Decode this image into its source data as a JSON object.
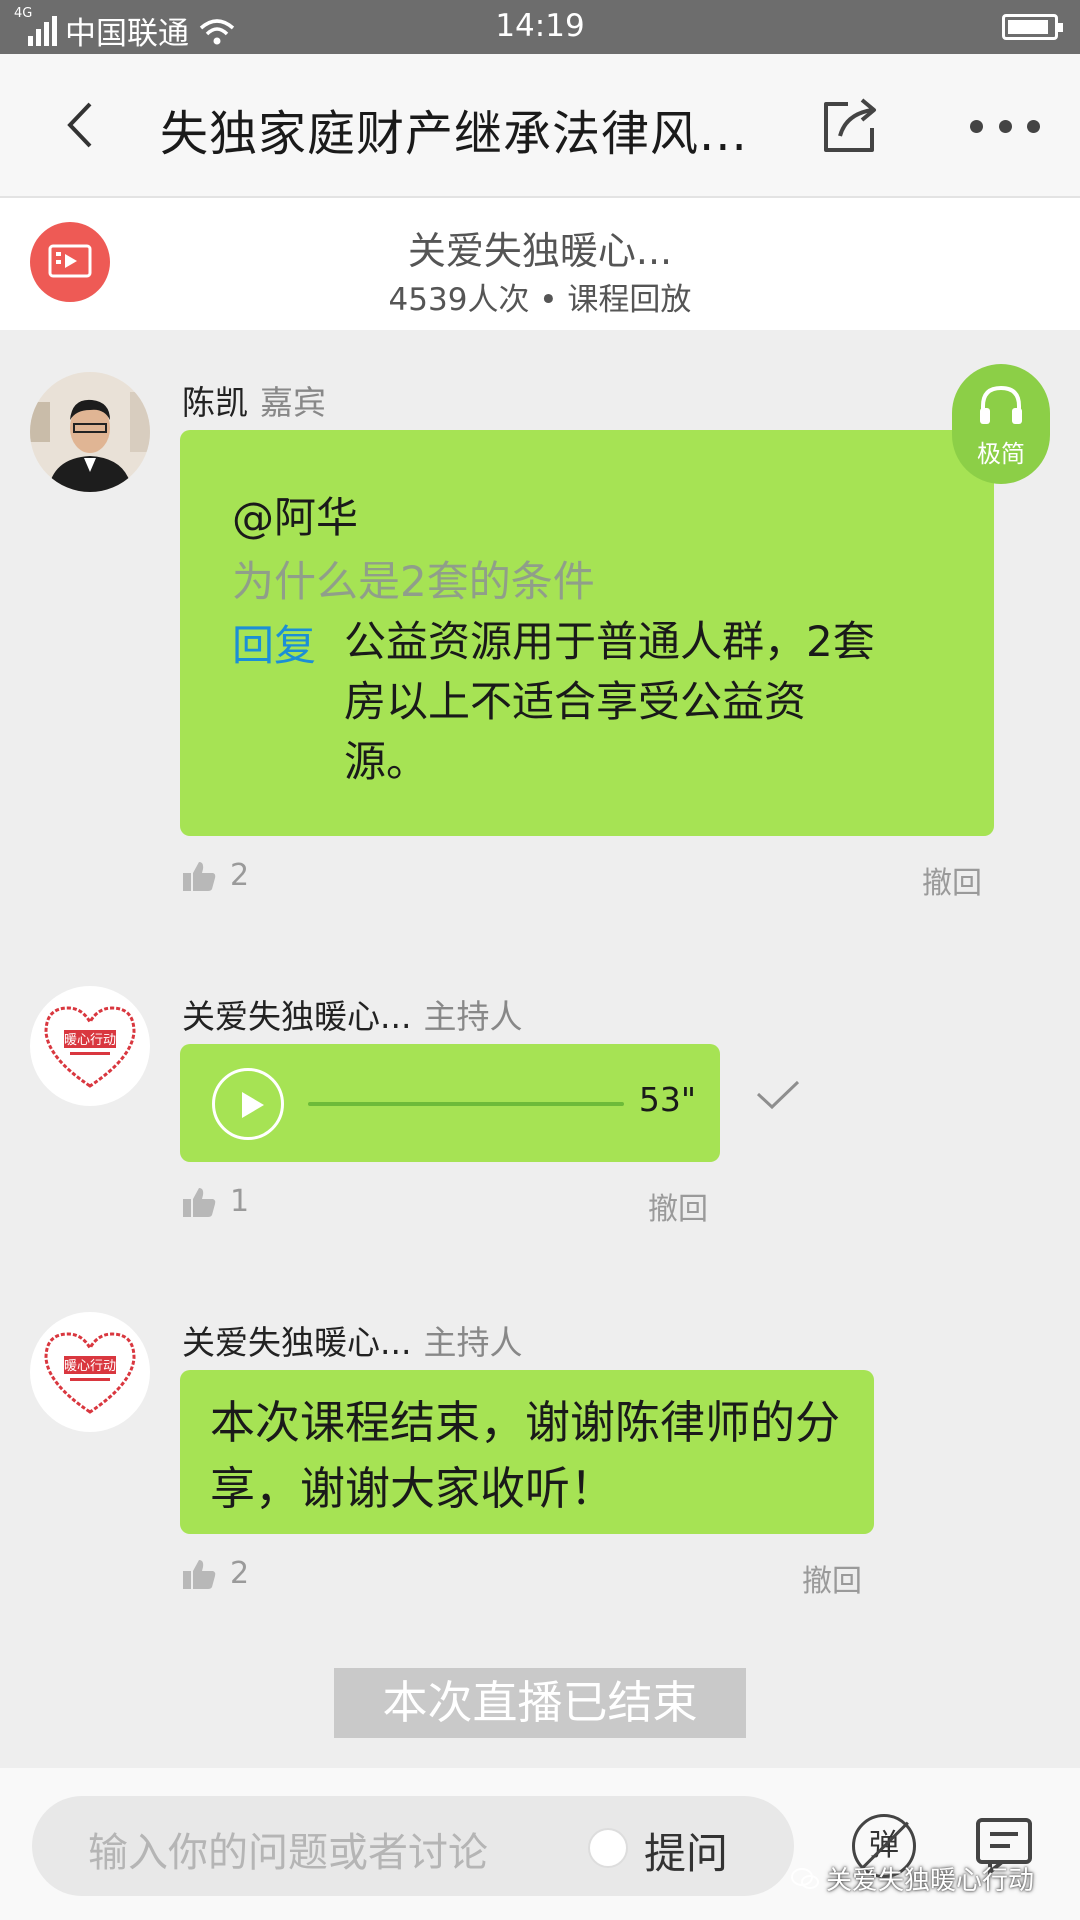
{
  "status_bar": {
    "network": "4G",
    "carrier": "中国联通",
    "time": "14:19"
  },
  "nav": {
    "title": "失独家庭财产继承法律风..."
  },
  "course": {
    "name": "关爱失独暖心...",
    "meta": "4539人次 • 课程回放"
  },
  "float_button": {
    "label": "极简"
  },
  "messages": [
    {
      "sender": "陈凯",
      "role": "嘉宾",
      "reply_at": "@阿华",
      "reply_quote": "为什么是2套的条件",
      "reply_tag": "回复",
      "reply_text": "公益资源用于普通人群，2套房以上不适合享受公益资源。",
      "likes": "2",
      "recall": "撤回"
    },
    {
      "sender": "关爱失独暖心...",
      "role": "主持人",
      "audio_duration": "53\"",
      "likes": "1",
      "recall": "撤回"
    },
    {
      "sender": "关爱失独暖心...",
      "role": "主持人",
      "text": "本次课程结束，谢谢陈律师的分享，谢谢大家收听！",
      "likes": "2",
      "recall": "撤回"
    }
  ],
  "live_ended": "本次直播已结束",
  "bottom": {
    "input_placeholder": "输入你的问题或者讨论",
    "ask_label": "提问",
    "danmaku_label": "弹",
    "watermark": "关爱失独暖心行动"
  },
  "logo_text": "暖心行动",
  "colors": {
    "bubble": "#a6e354",
    "accent_blue": "#1b8fd6",
    "float_button": "#8ccf47",
    "logo_red": "#d9373f"
  }
}
